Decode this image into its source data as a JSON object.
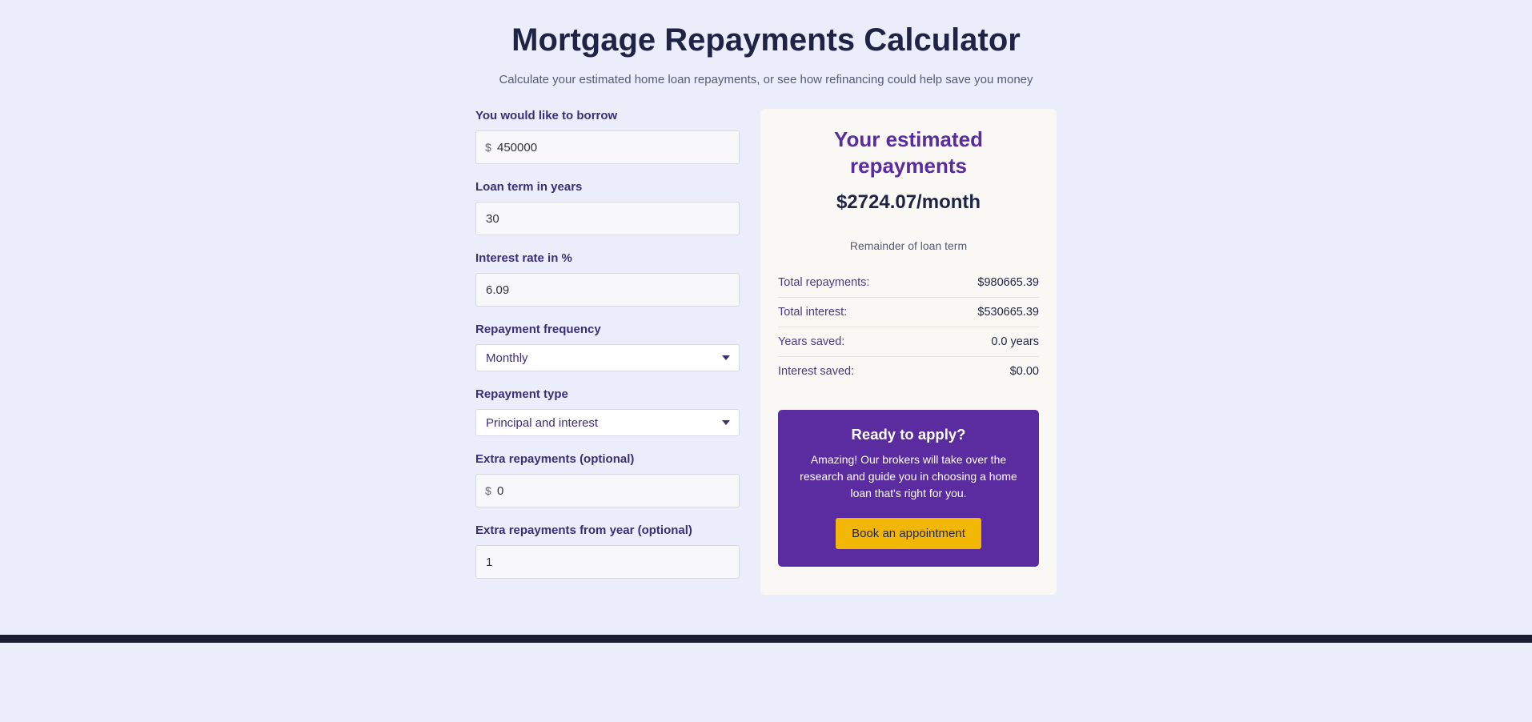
{
  "header": {
    "title": "Mortgage Repayments Calculator",
    "subtitle": "Calculate your estimated home loan repayments, or see how refinancing could help save you money"
  },
  "form": {
    "borrow_label": "You would like to borrow",
    "borrow_value": "450000",
    "currency_symbol": "$",
    "term_label": "Loan term in years",
    "term_value": "30",
    "rate_label": "Interest rate in %",
    "rate_value": "6.09",
    "frequency_label": "Repayment frequency",
    "frequency_value": "Monthly",
    "type_label": "Repayment type",
    "type_value": "Principal and interest",
    "extra_label": "Extra repayments (optional)",
    "extra_value": "0",
    "extra_from_label": "Extra repayments from year (optional)",
    "extra_from_value": "1"
  },
  "results": {
    "title": "Your estimated repayments",
    "amount": "$2724.07/month",
    "note": "Remainder of loan term",
    "rows": {
      "total_repayments_label": "Total repayments:",
      "total_repayments_value": "$980665.39",
      "total_interest_label": "Total interest:",
      "total_interest_value": "$530665.39",
      "years_saved_label": "Years saved:",
      "years_saved_value": "0.0 years",
      "interest_saved_label": "Interest saved:",
      "interest_saved_value": "$0.00"
    }
  },
  "cta": {
    "title": "Ready to apply?",
    "text": "Amazing! Our brokers will take over the research and guide you in choosing a home loan that's right for you.",
    "button": "Book an appointment"
  }
}
